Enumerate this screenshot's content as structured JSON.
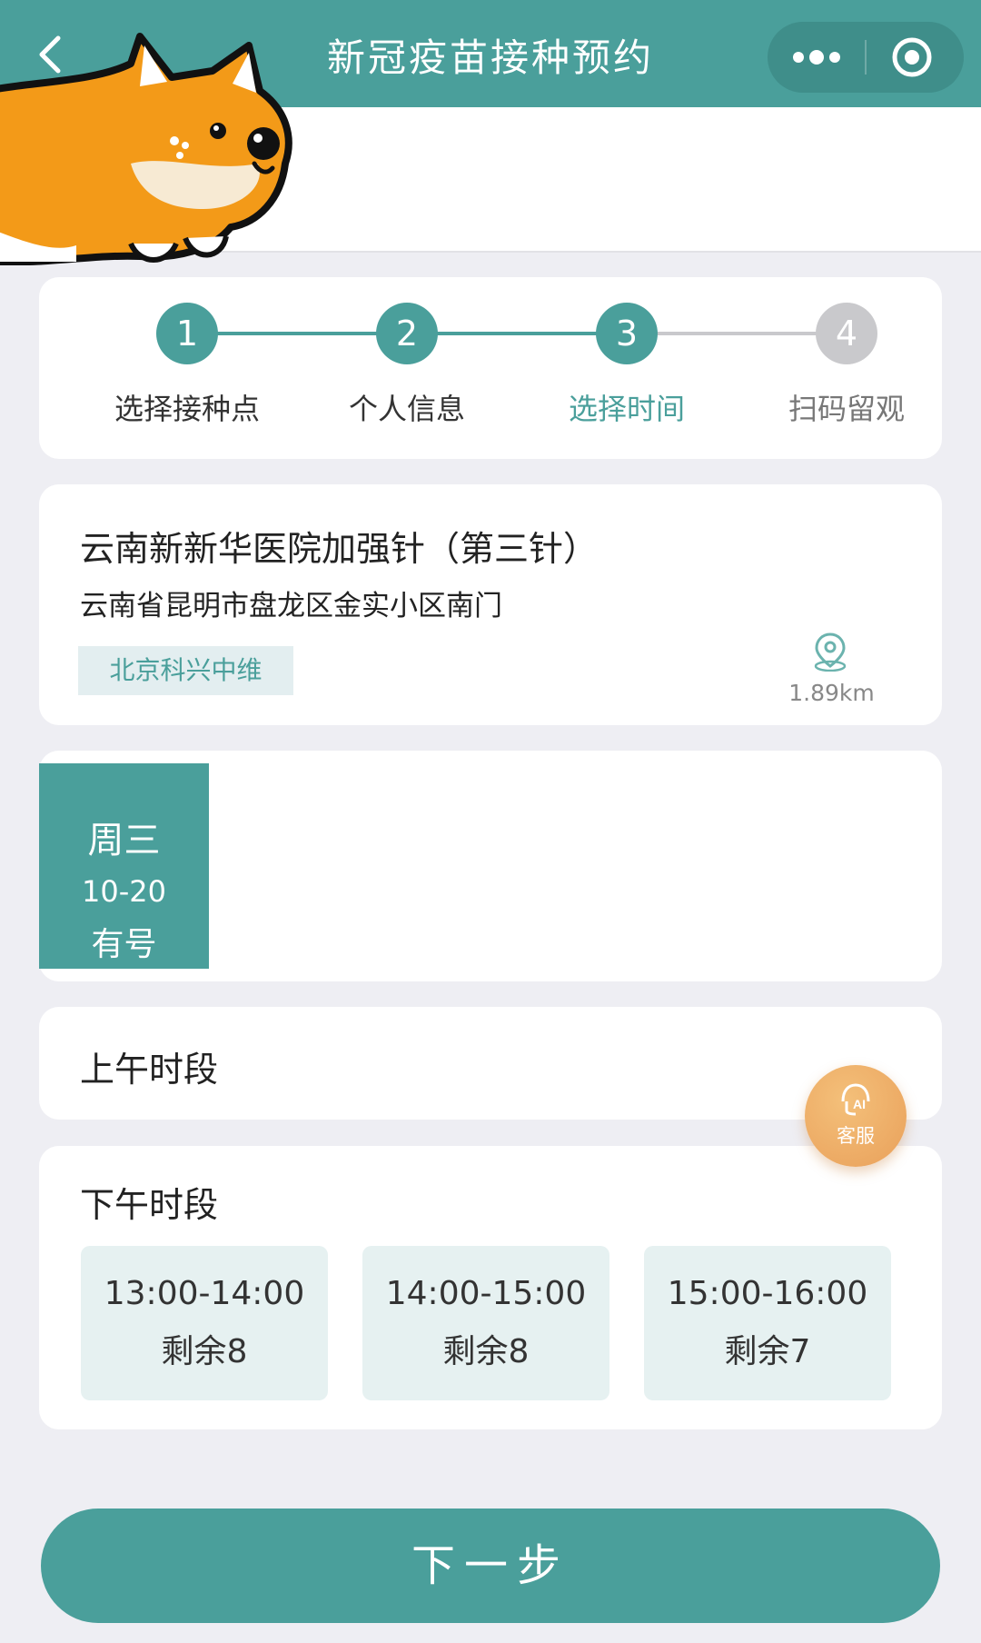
{
  "header": {
    "title": "新冠疫苗接种预约",
    "back_icon": "chevron-left-icon",
    "more_icon": "more-dots-icon",
    "close_icon": "target-circle-icon"
  },
  "steps": [
    {
      "num": "1",
      "label": "选择接种点",
      "state": "done"
    },
    {
      "num": "2",
      "label": "个人信息",
      "state": "done"
    },
    {
      "num": "3",
      "label": "选择时间",
      "state": "active"
    },
    {
      "num": "4",
      "label": "扫码留观",
      "state": "todo"
    }
  ],
  "site": {
    "name": "云南新新华医院加强针（第三针）",
    "address": "云南省昆明市盘龙区金实小区南门",
    "vendor": "北京科兴中维",
    "distance": "1.89km"
  },
  "date": {
    "weekday": "周三",
    "day": "10-20",
    "status": "有号"
  },
  "morning": {
    "title": "上午时段"
  },
  "afternoon": {
    "title": "下午时段",
    "slots": [
      {
        "time": "13:00-14:00",
        "remaining": "剩余8"
      },
      {
        "time": "14:00-15:00",
        "remaining": "剩余8"
      },
      {
        "time": "15:00-16:00",
        "remaining": "剩余7"
      }
    ]
  },
  "ai_service": {
    "label": "客服",
    "badge": "AI"
  },
  "next_button": "下一步",
  "colors": {
    "primary": "#4a9f9b",
    "inactive": "#c9c9cc",
    "accent": "#e9a05a"
  }
}
